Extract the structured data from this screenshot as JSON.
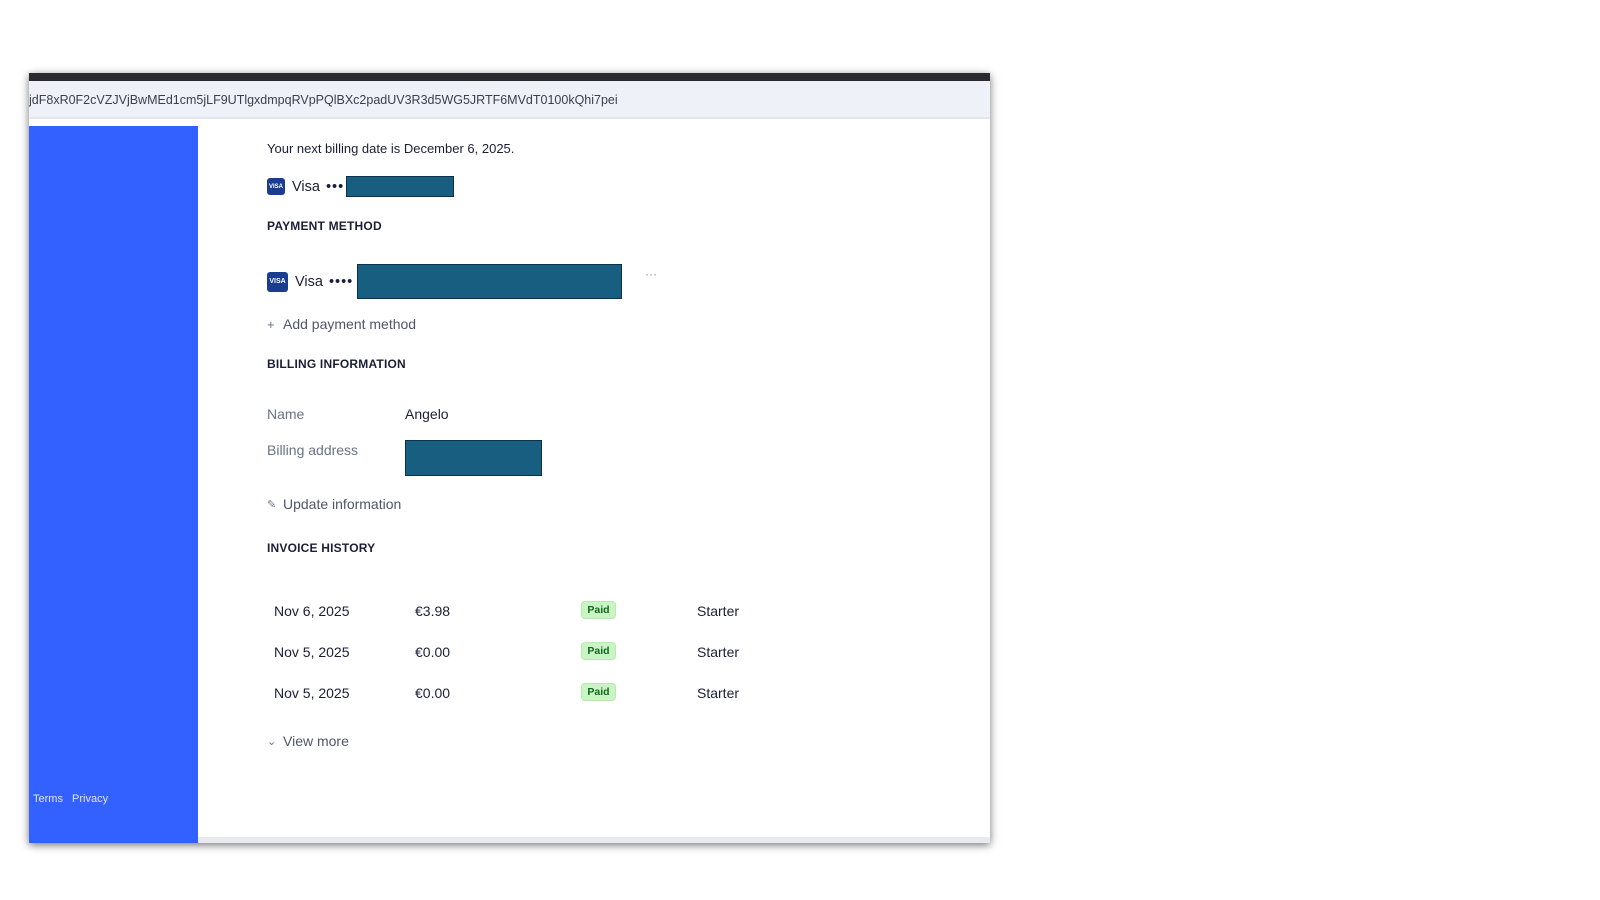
{
  "browser": {
    "url": "jdF8xR0F2cVZJVjBwMEd1cm5jLF9UTlgxdmpqRVpPQlBXc2padUV3R3d5WG5JRTF6MVdT0100kQhi7pei"
  },
  "sidebar": {
    "color": "#3361ff",
    "footer_links": [
      "Terms",
      "Privacy"
    ]
  },
  "subscription": {
    "next_billing_text": "Your next billing date is December 6, 2025.",
    "card_brand": "Visa",
    "card_mask": "•••"
  },
  "payment_method": {
    "title": "PAYMENT METHOD",
    "card_brand": "Visa",
    "card_mask": "••••",
    "more_glyph": "···",
    "add_label": "Add payment method"
  },
  "billing_information": {
    "title": "BILLING INFORMATION",
    "name_label": "Name",
    "name_value": "Angelo",
    "address_label": "Billing address",
    "update_label": "Update information"
  },
  "invoice_history": {
    "title": "INVOICE HISTORY",
    "rows": [
      {
        "date": "Nov 6, 2025",
        "amount": "€3.98",
        "status": "Paid",
        "plan": "Starter"
      },
      {
        "date": "Nov 5, 2025",
        "amount": "€0.00",
        "status": "Paid",
        "plan": "Starter"
      },
      {
        "date": "Nov 5, 2025",
        "amount": "€0.00",
        "status": "Paid",
        "plan": "Starter"
      }
    ],
    "view_more_label": "View more"
  },
  "colors": {
    "accent": "#3361ff",
    "redaction": "#175e80",
    "paid_badge_bg": "#c9f5c4",
    "paid_badge_text": "#11651c",
    "visa_icon": "#1a3d8f"
  },
  "icons": {
    "card": "visa-card-icon",
    "add": "plus-icon",
    "edit": "edit-icon",
    "expand": "chevron-down-icon",
    "more": "more-options-icon"
  }
}
